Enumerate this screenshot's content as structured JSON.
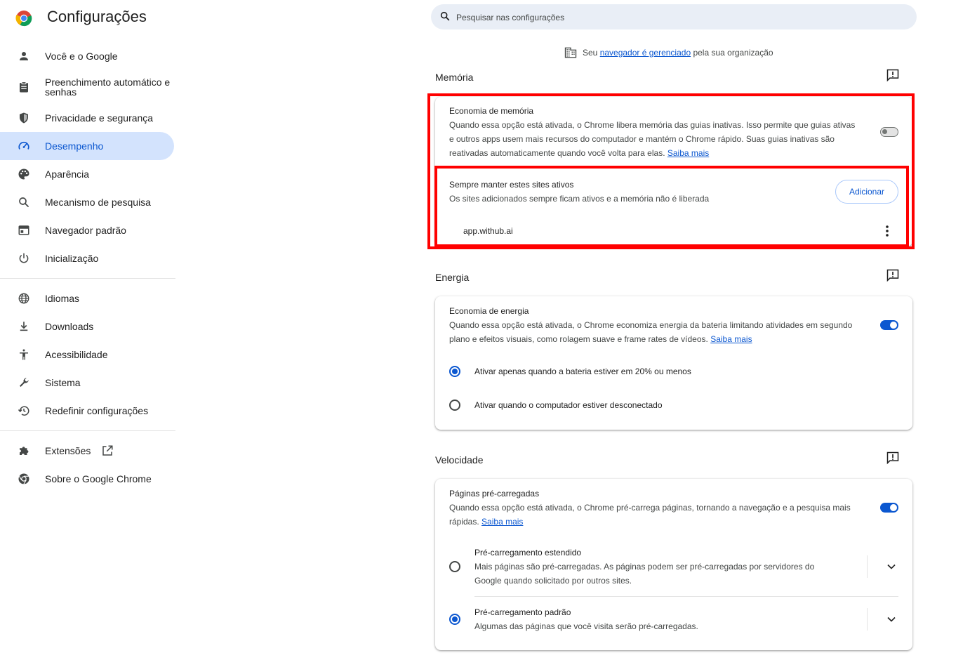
{
  "header": {
    "title": "Configurações"
  },
  "search": {
    "placeholder": "Pesquisar nas configurações"
  },
  "sidebar": {
    "items": [
      {
        "label": "Você e o Google",
        "icon": "person-icon"
      },
      {
        "label": "Preenchimento automático e senhas",
        "icon": "clipboard-icon"
      },
      {
        "label": "Privacidade e segurança",
        "icon": "shield-icon"
      },
      {
        "label": "Desempenho",
        "icon": "speedometer-icon",
        "active": true
      },
      {
        "label": "Aparência",
        "icon": "palette-icon"
      },
      {
        "label": "Mecanismo de pesquisa",
        "icon": "search-icon"
      },
      {
        "label": "Navegador padrão",
        "icon": "browser-window-icon"
      },
      {
        "label": "Inicialização",
        "icon": "power-icon"
      }
    ],
    "items2": [
      {
        "label": "Idiomas",
        "icon": "globe-icon"
      },
      {
        "label": "Downloads",
        "icon": "download-icon"
      },
      {
        "label": "Acessibilidade",
        "icon": "accessibility-icon"
      },
      {
        "label": "Sistema",
        "icon": "wrench-icon"
      },
      {
        "label": "Redefinir configurações",
        "icon": "history-icon"
      }
    ],
    "items3": [
      {
        "label": "Extensões",
        "icon": "puzzle-icon"
      },
      {
        "label": "Sobre o Google Chrome",
        "icon": "chrome-icon"
      }
    ]
  },
  "managed": {
    "prefix": "Seu ",
    "link": "navegador é gerenciado",
    "suffix": " pela sua organização"
  },
  "memory": {
    "title": "Memória",
    "saver_title": "Economia de memória",
    "saver_desc": "Quando essa opção está ativada, o Chrome libera memória das guias inativas. Isso permite que guias ativas e outros apps usem mais recursos do computador e mantém o Chrome rápido. Suas guias inativas são reativadas automaticamente quando você volta para elas.",
    "saver_link": "Saiba mais",
    "saver_enabled": false,
    "keep_title": "Sempre manter estes sites ativos",
    "keep_desc": "Os sites adicionados sempre ficam ativos e a memória não é liberada",
    "add_label": "Adicionar",
    "sites": [
      "app.withub.ai"
    ]
  },
  "energy": {
    "title": "Energia",
    "saver_title": "Economia de energia",
    "saver_desc": "Quando essa opção está ativada, o Chrome economiza energia da bateria limitando atividades em segundo plano e efeitos visuais, como rolagem suave e frame rates de vídeos.",
    "saver_link": "Saiba mais",
    "saver_enabled": true,
    "option1": "Ativar apenas quando a bateria estiver em 20% ou menos",
    "option2": "Ativar quando o computador estiver desconectado",
    "selected": 1
  },
  "speed": {
    "title": "Velocidade",
    "preload_title": "Páginas pré-carregadas",
    "preload_desc": "Quando essa opção está ativada, o Chrome pré-carrega páginas, tornando a navegação e a pesquisa mais rápidas.",
    "preload_link": "Saiba mais",
    "preload_enabled": true,
    "ext_title": "Pré-carregamento estendido",
    "ext_desc": "Mais páginas são pré-carregadas. As páginas podem ser pré-carregadas por servidores do Google quando solicitado por outros sites.",
    "std_title": "Pré-carregamento padrão",
    "std_desc": "Algumas das páginas que você visita serão pré-carregadas.",
    "selected": 2
  },
  "colors": {
    "accent": "#0b57d0",
    "active_bg": "#d3e3fd",
    "highlight": "#ff0000"
  }
}
